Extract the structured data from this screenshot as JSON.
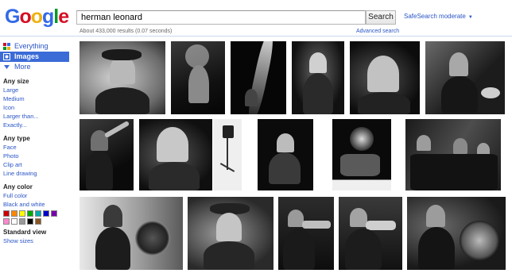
{
  "logo": {
    "letters": [
      "G",
      "o",
      "o",
      "g",
      "l",
      "e"
    ],
    "colors": [
      "#3369e8",
      "#d50f25",
      "#eeb211",
      "#3369e8",
      "#009925",
      "#d50f25"
    ]
  },
  "search": {
    "query": "herman leonard",
    "button_label": "Search"
  },
  "safesearch": {
    "label": "SafeSearch moderate",
    "caret": "▼"
  },
  "results": {
    "stats": "About 433,000 results (0.07 seconds)",
    "advanced_label": "Advanced search"
  },
  "nav": {
    "everything": "Everything",
    "images": "Images",
    "more": "More"
  },
  "filters": {
    "size": {
      "heading": "Any size",
      "options": [
        "Large",
        "Medium",
        "Icon",
        "Larger than...",
        "Exactly..."
      ]
    },
    "type": {
      "heading": "Any type",
      "options": [
        "Face",
        "Photo",
        "Clip art",
        "Line drawing"
      ]
    },
    "color": {
      "heading": "Any color",
      "options": [
        "Full color",
        "Black and white"
      ],
      "swatches": [
        "#cc0000",
        "#ff8800",
        "#ffff00",
        "#00aa00",
        "#00aaaa",
        "#0000cc",
        "#7700aa",
        "#ff88cc",
        "#ffffff",
        "#999999",
        "#000000",
        "#885522"
      ]
    },
    "view": {
      "heading": "Standard view",
      "options": [
        "Show sizes"
      ]
    }
  },
  "image_results": {
    "row_count": 3,
    "items_per_row": [
      6,
      7,
      5
    ],
    "style": "black-and-white photographs"
  }
}
